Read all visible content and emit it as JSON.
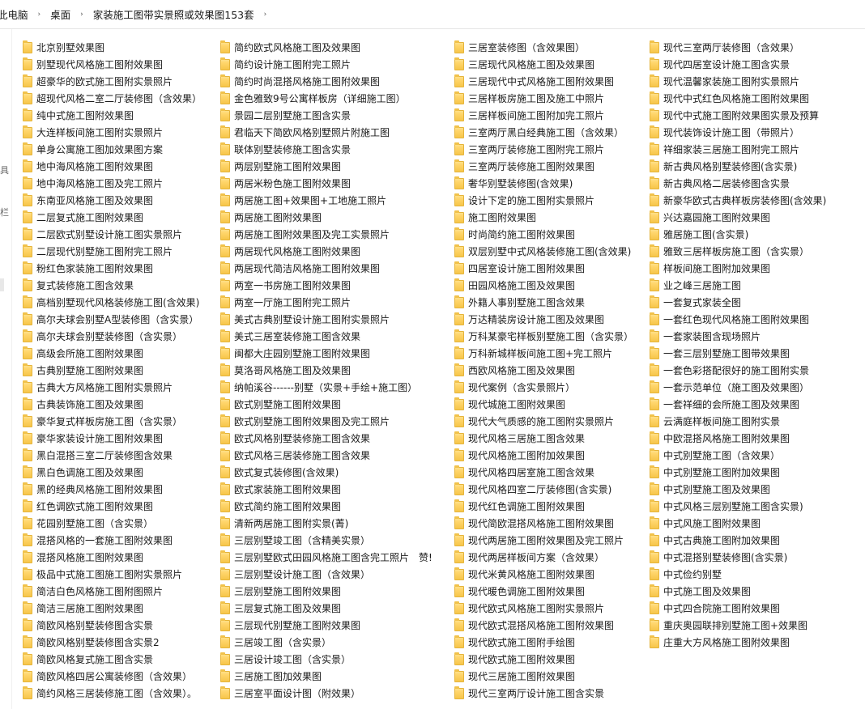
{
  "breadcrumb": [
    "此电脑",
    "桌面",
    "家装施工图带实景照或效果图153套"
  ],
  "breadcrumb_sep": "›",
  "nav_fragments": [
    "具",
    "栏"
  ],
  "columns": [
    [
      "北京别墅效果图",
      "别墅现代风格施工图附效果图",
      "超豪华的欧式施工图附实景照片",
      "超现代风格二室二厅装修图（含效果）",
      "纯中式施工图附效果图",
      "大连样板间施工图附实景照片",
      "单身公寓施工图加效果图方案",
      "地中海风格施工图附效果图",
      "地中海风格施工图及完工照片",
      "东南亚风格施工图及效果图",
      "二层复式施工图附效果图",
      "二层欧式别墅设计施工图实景照片",
      "二层现代别墅施工图附完工照片",
      "粉红色家装施工图附效果图",
      "复式装修施工图含效果",
      "高档别墅现代风格装修施工图(含效果)",
      "高尔夫球会别墅A型装修图（含实景）",
      "高尔夫球会别墅装修图（含实景）",
      "高级会所施工图附效果图",
      "古典别墅施工图附效果图",
      "古典大方风格施工图附实景照片",
      "古典装饰施工图及效果图",
      "豪华复式样板房施工图（含实景）",
      "豪华家装设计施工图附效果图",
      "黑白混搭三室二厅装修图含效果",
      "黑白色调施工图及效果图",
      "黑的经典风格施工图附效果图",
      "红色调欧式施工图附效果图",
      "花园别墅施工图（含实景）",
      "混搭风格的一套施工图附效果图",
      "混搭风格施工图附效果图",
      "极品中式施工图施工图附实景照片",
      "简洁白色风格施工图附图照片",
      "简洁三居施工图附效果图",
      "简欧风格别墅装修图含实景",
      "简欧风格别墅装修图含实景2",
      "简欧风格复式施工图含实景",
      "简欧风格四居公寓装修图（含效果）",
      "简约风格三居装修施工图（含效果）。"
    ],
    [
      "简约欧式风格施工图及效果图",
      "简约设计施工图附完工照片",
      "简约时尚混搭风格施工图附效果图",
      "金色雅致9号公寓样板房（详细施工图）",
      "景园二层别墅施工图含实景",
      "君临天下简欧风格别墅照片附施工图",
      "联体别墅装修施工图含实景",
      "两层别墅施工图附效果图",
      "两居米粉色施工图附效果图",
      "两居施工图+效果图+工地施工照片",
      "两居施工图附效果图",
      "两居施工图附效果图及完工实景照片",
      "两居现代风格施工图附效果图",
      "两居现代简洁风格施工图附效果图",
      "两室一书房施工图附效果图",
      "两室一厅施工图附完工照片",
      "美式古典别墅设计施工图附实景照片",
      "美式三居室装修施工图含效果",
      "闽都大庄园别墅施工图附效果图",
      "莫洛哥风格施工图及效果图",
      "纳帕溪谷------别墅（实景+手绘+施工图）",
      "欧式别墅施工图附效果图",
      "欧式别墅施工图附效果图及完工照片",
      "欧式风格别墅装修施工图含效果",
      "欧式风格三居装修施工图含效果",
      "欧式复式装修图(含效果)",
      "欧式家装施工图附效果图",
      "欧式简约施工图附效果图",
      "清新两居施工图附实景(菁)",
      "三层别墅竣工图（含精美实景）",
      "三层别墅欧式田园风格施工图含完工照片　赞!",
      "三层别墅设计施工图（含效果）",
      "三层别墅施工图附效果图",
      "三层复式施工图及效果图",
      "三层现代别墅施工图附效果图",
      "三居竣工图（含实景）",
      "三居设计竣工图（含实景）",
      "三居施工图加效果图",
      "三居室平面设计图（附效果）"
    ],
    [
      "三居室装修图（含效果图）",
      "三居现代风格施工图及效果图",
      "三居现代中式风格施工图附效果图",
      "三居样板房施工图及施工中照片",
      "三居样板间施工图附加完工照片",
      "三室两厅黑白经典施工图（含效果）",
      "三室两厅装修施工图附完工照片",
      "三室两厅装修施工图附效果图",
      "奢华别墅装修图(含效果)",
      "设计下定的施工图附实景照片",
      "施工图附效果图",
      "时尚简约施工图附效果图",
      "双层别墅中式风格装修施工图(含效果)",
      "四居室设计施工图附效果图",
      "田园风格施工图及效果图",
      "外籍人事别墅施工图含效果",
      "万达精装房设计施工图及效果图",
      "万科某豪宅样板别墅施工图（含实景）",
      "万科新城样板间施工图+完工照片",
      "西欧风格施工图及效果图",
      "现代案例（含实景照片）",
      "现代城施工图附效果图",
      "现代大气质感的施工图附实景照片",
      "现代风格三居施工图含效果",
      "现代风格施工图附加效果图",
      "现代风格四居室施工图含效果",
      "现代风格四室二厅装修图(含实景)",
      "现代红色调施工图附效果图",
      "现代简欧混搭风格施工图附效果图",
      "现代两居施工图附效果图及完工照片",
      "现代两居样板间方案（含效果）",
      "现代米黄风格施工图附效果图",
      "现代暖色调施工图附效果图",
      "现代欧式风格施工图附实景照片",
      "现代欧式混搭风格施工图附效果图",
      "现代欧式施工图附手绘图",
      "现代欧式施工图附效果图",
      "现代三居施工图附效果图",
      "现代三室两厅设计施工图含实景"
    ],
    [
      "现代三室两厅装修图（含效果）",
      "现代四居室设计施工图含实景",
      "现代温馨家装施工图附实景照片",
      "现代中式红色风格施工图附效果图",
      "现代中式施工图附效果图实景及预算",
      "现代装饰设计施工图（带照片）",
      "祥细家装三居施工图附完工照片",
      "新古典风格别墅装修图(含实景)",
      "新古典风格二居装修图含实景",
      "新豪华欧式古典样板房装修图(含效果)",
      "兴达嘉园施工图附效果图",
      "雅居施工图(含实景)",
      "雅致三居样板房施工图（含实景）",
      "样板间施工图附加效果图",
      "业之峰三居施工图",
      "一套复式家装全图",
      "一套红色现代风格施工图附效果图",
      "一套家装图含现场照片",
      "一套三层别墅施工图带效果图",
      "一套色彩搭配很好的施工图附实景",
      "一套示范单位（施工图及效果图）",
      "一套祥细的会所施工图及效果图",
      "云满庭样板间施工图附实景",
      "中欧混搭风格施工图附效果图",
      "中式别墅施工图（含效果）",
      "中式别墅施工图附加效果图",
      "中式别墅施工图及效果图",
      "中式风格三层别墅施工图含实景)",
      "中式风施工图附效果图",
      "中式古典施工图附加效果图",
      "中式混搭别墅装修图(含实景)",
      "中式俭约别墅",
      "中式施工图及效果图",
      "中式四合院施工图附效果图",
      "重庆奥园联排别墅施工图+效果图",
      "庄重大方风格施工图附效果图"
    ]
  ]
}
